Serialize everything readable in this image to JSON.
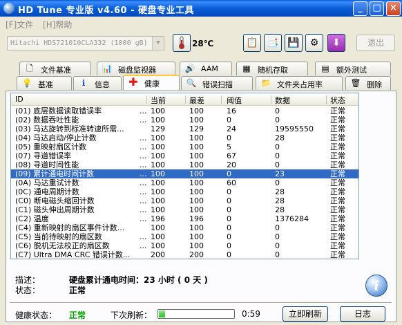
{
  "window": {
    "title": "HD Tune 专业版 v4.60 - 硬盘专业工具"
  },
  "menu": {
    "file": "[F]文件",
    "help": "[H]帮助"
  },
  "toolbar": {
    "drive": "Hitachi HDS721010CLA332 (1000 gB)",
    "temperature": "28℃",
    "exit_label": "退出"
  },
  "tabs_top": [
    {
      "label": "文件基准",
      "icon": "file-benchmark-icon"
    },
    {
      "label": "磁盘监视器",
      "icon": "disk-monitor-icon"
    },
    {
      "label": "AAM",
      "icon": "speaker-icon"
    },
    {
      "label": "随机存取",
      "icon": "random-access-icon"
    },
    {
      "label": "额外测试",
      "icon": "extra-tests-icon"
    }
  ],
  "tabs_bottom": [
    {
      "label": "基准",
      "icon": "benchmark-icon"
    },
    {
      "label": "信息",
      "icon": "info-icon"
    },
    {
      "label": "健康",
      "icon": "health-cross-icon",
      "active": true
    },
    {
      "label": "错误扫描",
      "icon": "magnifier-icon"
    },
    {
      "label": "文件夹占用率",
      "icon": "folder-icon"
    },
    {
      "label": "删除",
      "icon": "trash-icon"
    }
  ],
  "table": {
    "columns": [
      "ID",
      "当前",
      "最差",
      "阈值",
      "数据",
      "状态"
    ],
    "selected_index": 7,
    "rows": [
      {
        "id": "(01) 底层数据读取错误率",
        "dots": "...",
        "current": "100",
        "worst": "100",
        "threshold": "16",
        "data": "0",
        "status": "正常"
      },
      {
        "id": "(02) 数据吞吐性能",
        "dots": "...",
        "current": "100",
        "worst": "100",
        "threshold": "0",
        "data": "0",
        "status": "正常"
      },
      {
        "id": "(03) 马达旋转到标准转速所需...",
        "dots": "",
        "current": "129",
        "worst": "129",
        "threshold": "24",
        "data": "19595550",
        "status": "正常"
      },
      {
        "id": "(04) 马达启动/停止计数",
        "dots": "...",
        "current": "100",
        "worst": "100",
        "threshold": "0",
        "data": "28",
        "status": "正常"
      },
      {
        "id": "(05) 重映射扇区计数",
        "dots": "...",
        "current": "100",
        "worst": "100",
        "threshold": "5",
        "data": "0",
        "status": "正常"
      },
      {
        "id": "(07) 寻道错误率",
        "dots": "...",
        "current": "100",
        "worst": "100",
        "threshold": "67",
        "data": "0",
        "status": "正常"
      },
      {
        "id": "(08) 寻道时间性能",
        "dots": "...",
        "current": "100",
        "worst": "100",
        "threshold": "20",
        "data": "0",
        "status": "正常"
      },
      {
        "id": "(09) 累计通电时间计数",
        "dots": "...",
        "current": "100",
        "worst": "100",
        "threshold": "0",
        "data": "23",
        "status": "正常"
      },
      {
        "id": "(0A) 马达重试计数",
        "dots": "...",
        "current": "100",
        "worst": "100",
        "threshold": "60",
        "data": "0",
        "status": "正常"
      },
      {
        "id": "(0C) 通电周期计数",
        "dots": "...",
        "current": "100",
        "worst": "100",
        "threshold": "0",
        "data": "28",
        "status": "正常"
      },
      {
        "id": "(C0) 断电磁头缩回计数",
        "dots": "...",
        "current": "100",
        "worst": "100",
        "threshold": "0",
        "data": "28",
        "status": "正常"
      },
      {
        "id": "(C1) 磁头伸出周期计数",
        "dots": "...",
        "current": "100",
        "worst": "100",
        "threshold": "0",
        "data": "28",
        "status": "正常"
      },
      {
        "id": "(C2) 温度",
        "dots": "...",
        "current": "196",
        "worst": "196",
        "threshold": "0",
        "data": "1376284",
        "status": "正常"
      },
      {
        "id": "(C4) 重新映射的扇区事件计数...",
        "dots": "",
        "current": "100",
        "worst": "100",
        "threshold": "0",
        "data": "0",
        "status": "正常"
      },
      {
        "id": "(C5) 当前待映射的扇区数",
        "dots": "...",
        "current": "100",
        "worst": "100",
        "threshold": "0",
        "data": "0",
        "status": "正常"
      },
      {
        "id": "(C6) 脱机无法校正的扇区数",
        "dots": "...",
        "current": "100",
        "worst": "100",
        "threshold": "0",
        "data": "0",
        "status": "正常"
      },
      {
        "id": "(C7) Ultra DMA CRC 错误计数...",
        "dots": "",
        "current": "200",
        "worst": "200",
        "threshold": "0",
        "data": "0",
        "status": "正常"
      }
    ]
  },
  "details": {
    "desc_label": "描述：",
    "desc_value": "硬盘累计通电时间：23 小时 ( 0 天 )",
    "status_label": "状态：",
    "status_value": "正常"
  },
  "statusbar": {
    "health_label": "健康状态：",
    "health_value": "正常",
    "health_color": "#00a000",
    "next_refresh_label": "下次刷新：",
    "progress_fraction": 0.08,
    "countdown": "0:59",
    "refresh_button": "立即刷新",
    "log_button": "日志"
  }
}
